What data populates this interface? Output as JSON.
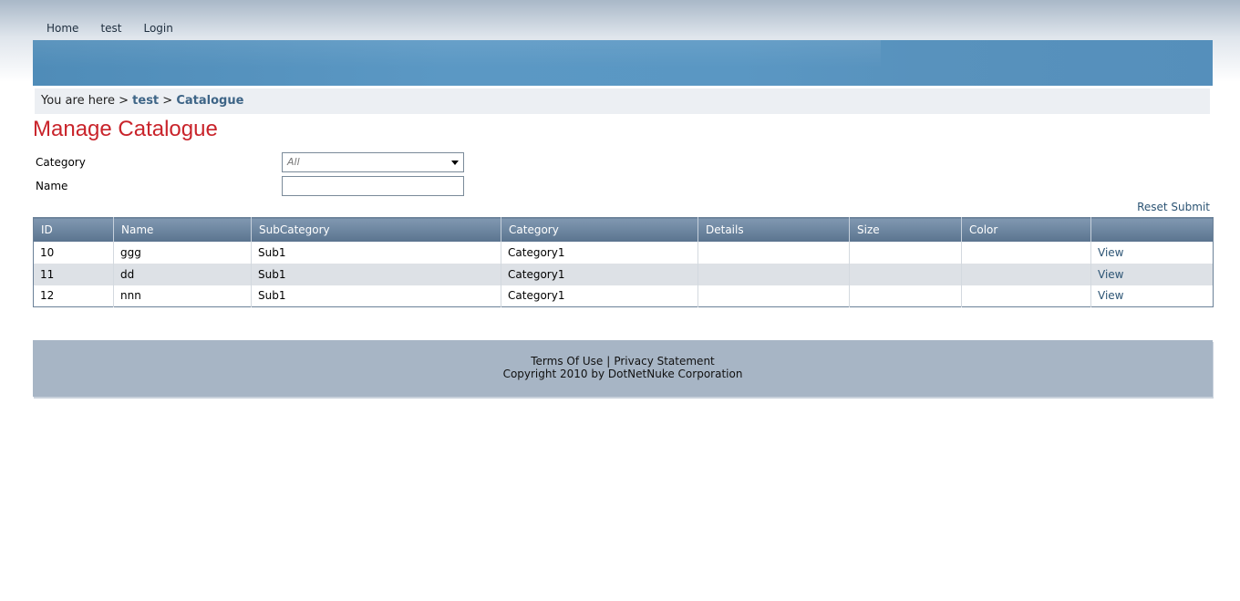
{
  "nav": {
    "items": [
      {
        "label": "Home"
      },
      {
        "label": "test"
      },
      {
        "label": "Login"
      }
    ]
  },
  "breadcrumb": {
    "prefix": "You are here >",
    "items": [
      "test",
      "Catalogue"
    ],
    "separator": ">"
  },
  "page": {
    "title": "Manage Catalogue"
  },
  "filters": {
    "category_label": "Category",
    "category_value": "All",
    "name_label": "Name",
    "name_value": ""
  },
  "actions": {
    "reset_label": "Reset",
    "submit_label": "Submit"
  },
  "table": {
    "columns": [
      "ID",
      "Name",
      "SubCategory",
      "Category",
      "Details",
      "Size",
      "Color",
      ""
    ],
    "rows": [
      {
        "id": "10",
        "name": "ggg",
        "subcategory": "Sub1",
        "category": "Category1",
        "details": "",
        "size": "",
        "color": "",
        "action": "View"
      },
      {
        "id": "11",
        "name": "dd",
        "subcategory": "Sub1",
        "category": "Category1",
        "details": "",
        "size": "",
        "color": "",
        "action": "View"
      },
      {
        "id": "12",
        "name": "nnn",
        "subcategory": "Sub1",
        "category": "Category1",
        "details": "",
        "size": "",
        "color": "",
        "action": "View"
      }
    ]
  },
  "footer": {
    "terms": "Terms Of Use",
    "separator": "|",
    "privacy": "Privacy Statement",
    "copyright": "Copyright 2010 by DotNetNuke Corporation"
  },
  "colors": {
    "title": "#c9242b",
    "banner": "#5a97c3",
    "link": "#2c5474",
    "footer_bg": "#a7b5c5"
  }
}
